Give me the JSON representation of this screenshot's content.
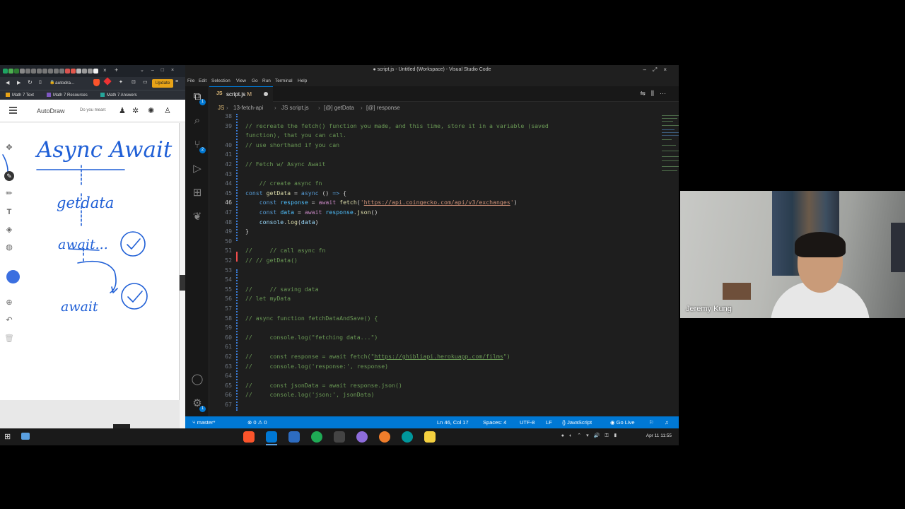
{
  "browser": {
    "url": "autodra...",
    "update_label": "Update",
    "bookmarks": [
      "Math 7 Text",
      "Math 7 Resources",
      "Math 7 Answers"
    ],
    "app_name": "AutoDraw",
    "hint": "Do you mean:",
    "drawing": [
      "Async Await",
      "getdata",
      "await...",
      "await"
    ]
  },
  "vscode": {
    "title": "● script.js - Untitled (Workspace) - Visual Studio Code",
    "menu": [
      "File",
      "Edit",
      "Selection",
      "View",
      "Go",
      "Run",
      "Terminal",
      "Help"
    ],
    "tab": {
      "icon": "JS",
      "name": "script.js",
      "status": "M"
    },
    "breadcrumb": [
      "JS",
      "13-fetch-api",
      "JS script.js",
      "[@] getData",
      "[@] response"
    ],
    "activity_badges": [
      "1",
      "2",
      "1"
    ],
    "status": {
      "branch": "master*",
      "problems": "⊗ 0 ⚠ 0",
      "position": "Ln 46, Col 17",
      "spaces": "Spaces: 4",
      "encoding": "UTF-8",
      "eol": "LF",
      "language": "{} JavaScript",
      "golive": "Go Live"
    }
  },
  "webcam": {
    "name": "Jeremy Kung"
  },
  "taskbar": {
    "clock": "Apr 11  11:55"
  },
  "colors": {
    "accent": "#0078d4",
    "editor_bg": "#1e1e1e",
    "status_bar": "#0078d4"
  }
}
